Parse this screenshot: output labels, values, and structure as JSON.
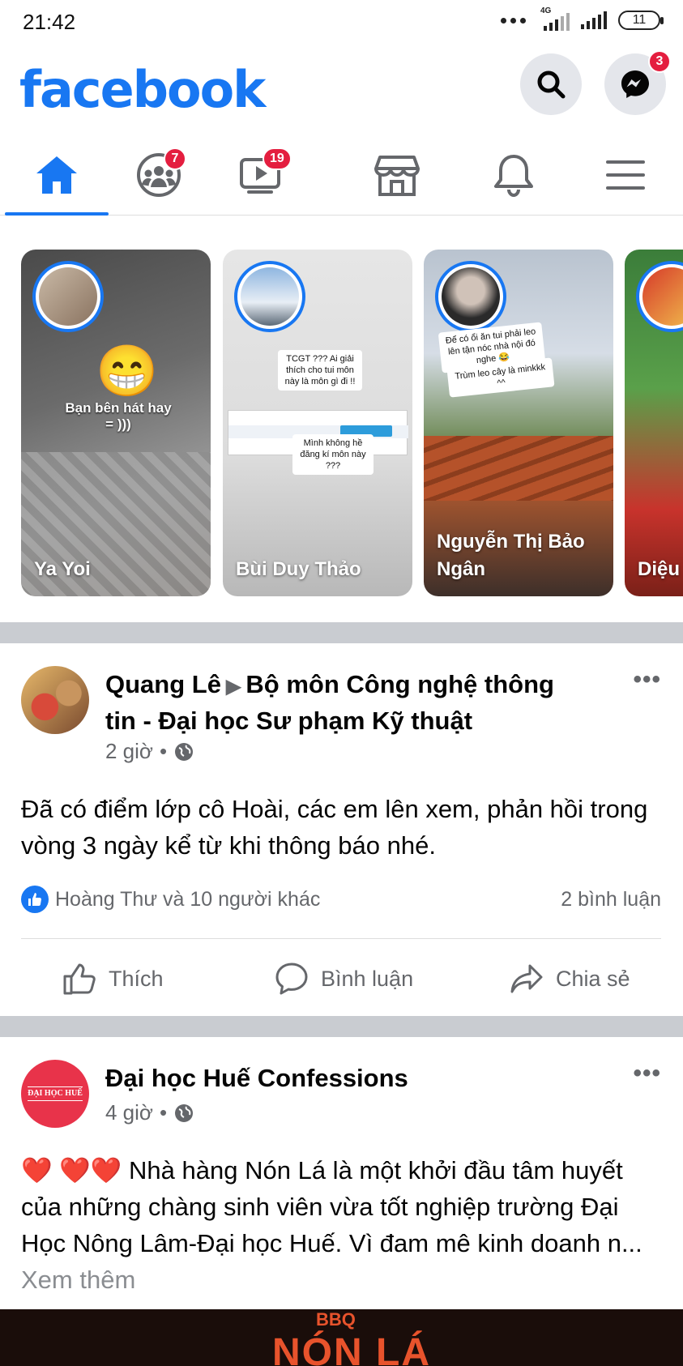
{
  "status_bar": {
    "time": "21:42",
    "network": "4G",
    "battery": "11"
  },
  "header": {
    "logo": "facebook",
    "messenger_badge": "3",
    "icons": [
      "search-icon",
      "messenger-icon"
    ]
  },
  "nav": {
    "items": [
      {
        "name": "home",
        "icon": "home-icon",
        "badge": ""
      },
      {
        "name": "groups",
        "icon": "groups-icon",
        "badge": "7"
      },
      {
        "name": "watch",
        "icon": "video-icon",
        "badge": "19"
      },
      {
        "name": "marketplace",
        "icon": "store-icon",
        "badge": ""
      },
      {
        "name": "notifications",
        "icon": "bell-icon",
        "badge": ""
      },
      {
        "name": "menu",
        "icon": "hamburger-icon",
        "badge": ""
      }
    ]
  },
  "stories": [
    {
      "name": "Ya Yoi",
      "caption": "Bạn bên hát hay\n= )))"
    },
    {
      "name": "Bùi Duy Thảo",
      "caption": "TCGT ??? Ai giải thích cho tui môn này là môn gì đi !!",
      "caption2": "Mình không hề đăng kí môn này ???"
    },
    {
      "name": "Nguyễn Thị Bảo Ngân",
      "caption": "Để có ổi ăn tui phải leo lên tận nóc nhà nội đó nghe 😂",
      "caption2": "Trùm leo cây là minkkk ^^"
    },
    {
      "name": "Diệu"
    }
  ],
  "posts": [
    {
      "author": "Quang Lê",
      "target": "Bộ môn Công nghệ thông tin - Đại học Sư phạm Kỹ thuật",
      "time": "2 giờ",
      "dot": "•",
      "text": "Đã có điểm lớp cô Hoài, các em lên xem, phản hồi trong vòng 3 ngày kể từ khi thông báo nhé.",
      "reactions": "Hoàng Thư và 10 người khác",
      "comments": "2 bình luận",
      "actions": {
        "like": "Thích",
        "comment": "Bình luận",
        "share": "Chia sẻ"
      }
    },
    {
      "author": "Đại học Huế Confessions",
      "avatar_text": "ĐẠI HỌC HUẾ",
      "time": "4 giờ",
      "dot": "•",
      "hearts": "❤️ ❤️❤️",
      "text": "Nhà hàng Nón Lá là một khởi đầu tâm huyết của những chàng sinh viên vừa tốt nghiệp trường Đại Học Nông Lâm-Đại học Huế. Vì đam mê kinh doanh n...",
      "see_more": "Xem thêm",
      "banner_text": "BBQ",
      "banner_title": "NÓN LÁ"
    }
  ],
  "colors": {
    "brand": "#1877f2",
    "badge": "#e41e3f",
    "secondary_text": "#65676b",
    "separator": "#c9ccd1"
  }
}
